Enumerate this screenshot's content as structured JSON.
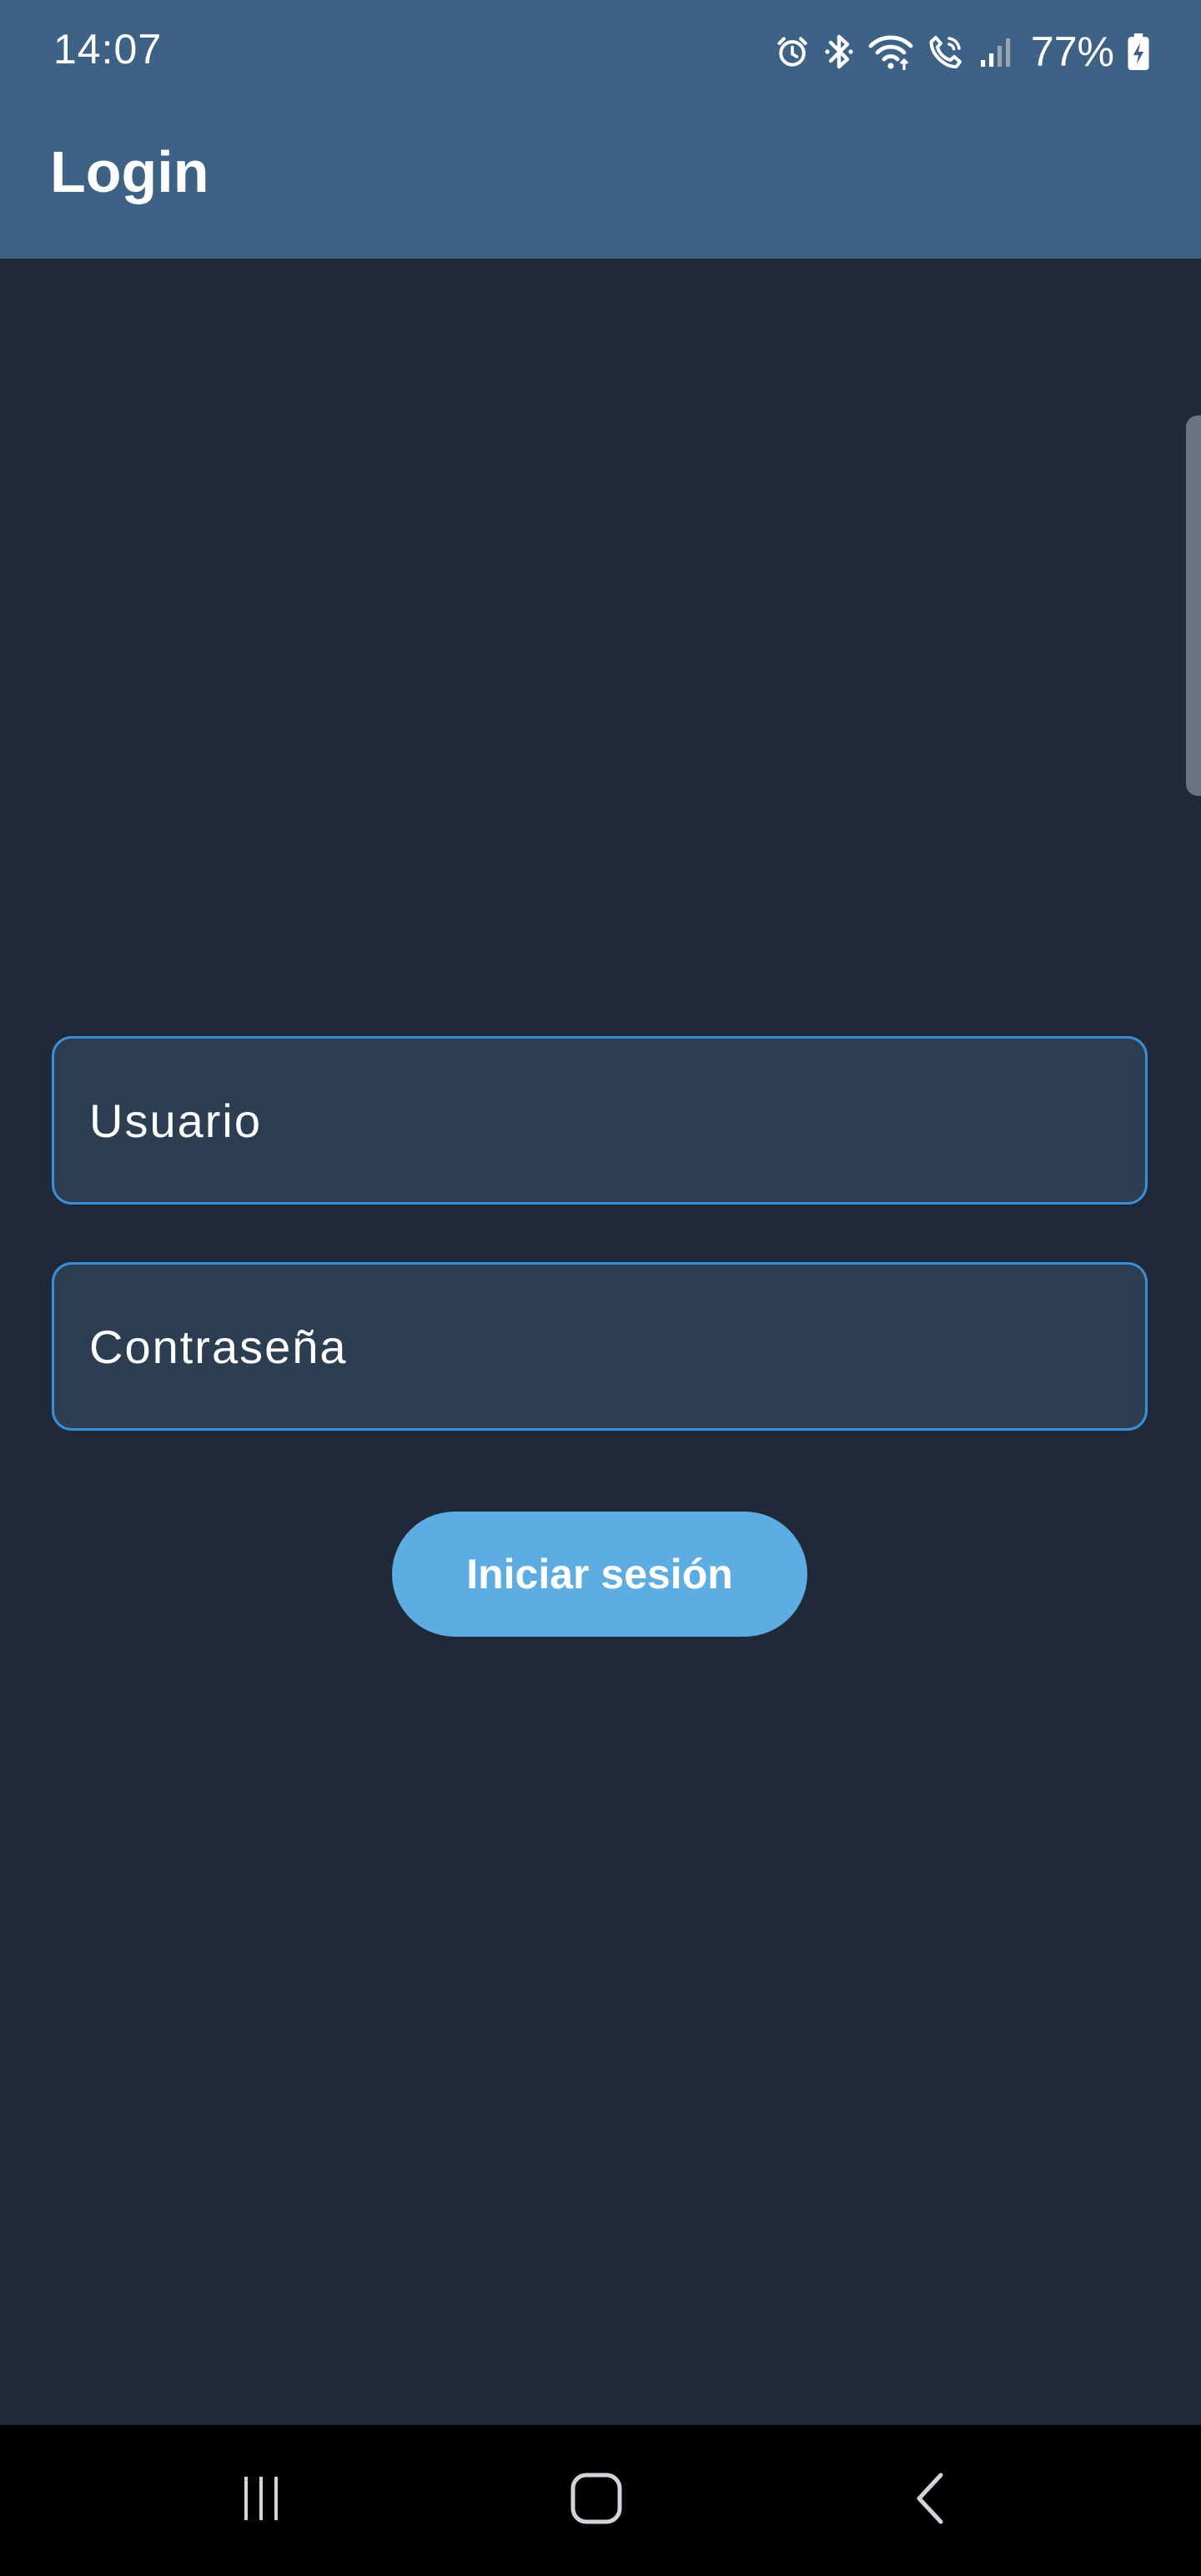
{
  "status_bar": {
    "time": "14:07",
    "battery_percent": "77%",
    "icons": [
      "alarm-icon",
      "bluetooth-icon",
      "wifi-icon",
      "wifi-calling-icon",
      "signal-icon",
      "battery-charging-icon"
    ]
  },
  "app_bar": {
    "title": "Login"
  },
  "form": {
    "username": {
      "placeholder": "Usuario",
      "value": ""
    },
    "password": {
      "placeholder": "Contraseña",
      "value": ""
    },
    "submit_label": "Iniciar sesión"
  },
  "nav_bar": {
    "buttons": [
      "recents-icon",
      "home-icon",
      "back-icon"
    ]
  },
  "colors": {
    "app_bar": "#3d6285",
    "background": "#1f2937",
    "field_fill": "#2d3e52",
    "field_border": "#3b8fd6",
    "button": "#5dade2"
  }
}
